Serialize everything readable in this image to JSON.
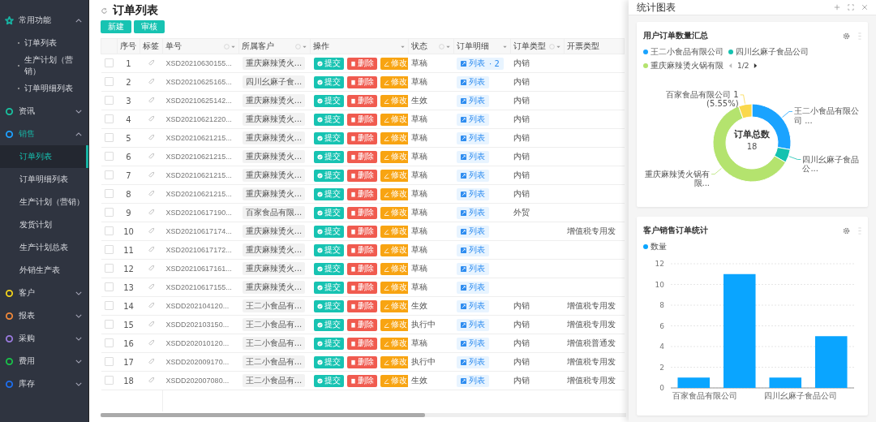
{
  "sidebar": {
    "groups": [
      {
        "label": "常用功能",
        "kind": "star",
        "color": "#17b3a3",
        "expanded": true,
        "children": [
          {
            "label": "订单列表",
            "selected": false
          },
          {
            "label": "生产计划（营销）",
            "selected": false
          },
          {
            "label": "订单明细列表",
            "selected": false
          }
        ]
      },
      {
        "label": "资讯",
        "kind": "ring",
        "color": "#19c2a0",
        "expanded": false
      },
      {
        "label": "销售",
        "kind": "ring",
        "color": "#1ea0ff",
        "expanded": true,
        "children": [
          {
            "label": "订单列表",
            "selected": true
          },
          {
            "label": "订单明细列表",
            "selected": false
          },
          {
            "label": "生产计划（营销）",
            "selected": false
          },
          {
            "label": "发货计划",
            "selected": false
          },
          {
            "label": "生产计划总表",
            "selected": false
          },
          {
            "label": "外销生产表",
            "selected": false
          }
        ]
      },
      {
        "label": "客户",
        "kind": "ring",
        "color": "#f2d21b",
        "expanded": false
      },
      {
        "label": "报表",
        "kind": "ring",
        "color": "#f0883a",
        "expanded": false
      },
      {
        "label": "采购",
        "kind": "ring",
        "color": "#9b7be0",
        "expanded": false
      },
      {
        "label": "费用",
        "kind": "ring",
        "color": "#19c34a",
        "expanded": false
      },
      {
        "label": "库存",
        "kind": "ring",
        "color": "#1e6ff0",
        "expanded": false
      }
    ]
  },
  "page": {
    "title": "订单列表",
    "buttons": [
      "新建",
      "审核"
    ]
  },
  "table": {
    "columns": [
      {
        "label": "序号",
        "info": false,
        "filter": false
      },
      {
        "label": "标签",
        "info": false,
        "filter": false
      },
      {
        "label": "单号",
        "info": true,
        "filter": true
      },
      {
        "label": "所属客户",
        "info": true,
        "filter": true
      },
      {
        "label": "操作",
        "info": false,
        "filter": true
      },
      {
        "label": "状态",
        "info": true,
        "filter": true
      },
      {
        "label": "订单明细",
        "info": false,
        "filter": true
      },
      {
        "label": "订单类型",
        "info": true,
        "filter": true
      },
      {
        "label": "开票类型",
        "info": false,
        "filter": false
      }
    ],
    "rows": [
      {
        "checked": false,
        "no": "1",
        "order": "XSD20210630155...",
        "customer": "重庆麻辣烫火...",
        "actions": [
          "提交",
          "删除",
          "修改"
        ],
        "status": "草稿",
        "detail": "列表",
        "detail_count": "· 2",
        "type": "内销",
        "invoice": ""
      },
      {
        "checked": false,
        "no": "2",
        "order": "XSD20210625165...",
        "customer": "四川幺麻子食...",
        "actions": [
          "提交",
          "删除",
          "修改"
        ],
        "status": "草稿",
        "detail": "列表",
        "type": "内销",
        "invoice": ""
      },
      {
        "checked": false,
        "no": "3",
        "order": "XSD20210625142...",
        "customer": "重庆麻辣烫火...",
        "actions": [
          "提交",
          "删除",
          "修改"
        ],
        "status": "生效",
        "detail": "列表",
        "type": "内销",
        "invoice": ""
      },
      {
        "checked": false,
        "no": "4",
        "order": "XSD20210621220...",
        "customer": "重庆麻辣烫火...",
        "actions": [
          "提交",
          "删除",
          "修改"
        ],
        "status": "草稿",
        "detail": "列表",
        "type": "内销",
        "invoice": ""
      },
      {
        "checked": false,
        "no": "5",
        "order": "XSD20210621215...",
        "customer": "重庆麻辣烫火...",
        "actions": [
          "提交",
          "删除",
          "修改"
        ],
        "status": "草稿",
        "detail": "列表",
        "type": "内销",
        "invoice": ""
      },
      {
        "checked": false,
        "no": "6",
        "order": "XSD20210621215...",
        "customer": "重庆麻辣烫火...",
        "actions": [
          "提交",
          "删除",
          "修改"
        ],
        "status": "草稿",
        "detail": "列表",
        "type": "内销",
        "invoice": ""
      },
      {
        "checked": false,
        "no": "7",
        "order": "XSD20210621215...",
        "customer": "重庆麻辣烫火...",
        "actions": [
          "提交",
          "删除",
          "修改"
        ],
        "status": "草稿",
        "detail": "列表",
        "type": "内销",
        "invoice": ""
      },
      {
        "checked": false,
        "no": "8",
        "order": "XSD20210621215...",
        "customer": "重庆麻辣烫火...",
        "actions": [
          "提交",
          "删除",
          "修改"
        ],
        "status": "草稿",
        "detail": "列表",
        "type": "内销",
        "invoice": ""
      },
      {
        "checked": false,
        "no": "9",
        "order": "XSD20210617190...",
        "customer": "百家食品有限...",
        "actions": [
          "提交",
          "删除",
          "修改"
        ],
        "status": "草稿",
        "detail": "列表",
        "type": "外贸",
        "invoice": ""
      },
      {
        "checked": false,
        "no": "10",
        "order": "XSD20210617174...",
        "customer": "重庆麻辣烫火...",
        "actions": [
          "提交",
          "删除",
          "修改"
        ],
        "status": "草稿",
        "detail": "列表",
        "type": "",
        "invoice": "增值税专用发"
      },
      {
        "checked": false,
        "no": "11",
        "order": "XSD20210617172...",
        "customer": "重庆麻辣烫火...",
        "actions": [
          "提交",
          "删除",
          "修改"
        ],
        "status": "草稿",
        "detail": "列表",
        "type": "",
        "invoice": ""
      },
      {
        "checked": false,
        "no": "12",
        "order": "XSD20210617161...",
        "customer": "重庆麻辣烫火...",
        "actions": [
          "提交",
          "删除",
          "修改"
        ],
        "status": "草稿",
        "detail": "列表",
        "type": "",
        "invoice": ""
      },
      {
        "checked": false,
        "no": "13",
        "order": "XSD20210617155...",
        "customer": "重庆麻辣烫火...",
        "actions": [
          "提交",
          "删除",
          "修改"
        ],
        "status": "草稿",
        "detail": "列表",
        "type": "",
        "invoice": ""
      },
      {
        "checked": false,
        "no": "14",
        "order": "XSDD202104120...",
        "customer": "王二小食品有...",
        "actions": [
          "提交",
          "删除",
          "修改"
        ],
        "status": "生效",
        "detail": "列表",
        "type": "内销",
        "invoice": "增值税专用发"
      },
      {
        "checked": false,
        "no": "15",
        "order": "XSDD202103150...",
        "customer": "王二小食品有...",
        "actions": [
          "提交",
          "删除",
          "修改"
        ],
        "status": "执行中",
        "detail": "列表",
        "type": "内销",
        "invoice": "增值税专用发"
      },
      {
        "checked": false,
        "no": "16",
        "order": "XSDD202010120...",
        "customer": "王二小食品有...",
        "actions": [
          "提交",
          "删除",
          "修改"
        ],
        "status": "草稿",
        "detail": "列表",
        "type": "内销",
        "invoice": "增值税普通发"
      },
      {
        "checked": false,
        "no": "17",
        "order": "XSDD202009170...",
        "customer": "王二小食品有...",
        "actions": [
          "提交",
          "删除",
          "修改"
        ],
        "status": "执行中",
        "detail": "列表",
        "type": "内销",
        "invoice": "增值税专用发"
      },
      {
        "checked": false,
        "no": "18",
        "order": "XSDD202007080...",
        "customer": "王二小食品有...",
        "actions": [
          "提交",
          "删除",
          "修改"
        ],
        "status": "生效",
        "detail": "列表",
        "type": "内销",
        "invoice": "增值税专用发"
      }
    ]
  },
  "drawer": {
    "title": "统计图表",
    "donut_card": {
      "title": "用户订单数量汇总",
      "legend": [
        {
          "name": "王二小食品有限公司",
          "color": "#1aa3ff"
        },
        {
          "name": "四川幺麻子食品公司",
          "color": "#14c2b0"
        },
        {
          "name": "重庆麻辣烫火锅有限",
          "color": "#b4e36e"
        }
      ],
      "legend_page": "1/2",
      "center_title": "订单总数",
      "center_value": "18",
      "chart_data": {
        "type": "donut",
        "categories": [
          "王二小食品有限公司 ...",
          "四川幺麻子食品公...",
          "重庆麻辣烫火锅有限...",
          "百家食品有限公司 1 (5.55%)"
        ],
        "values": [
          5,
          1,
          11,
          1
        ],
        "colors": [
          "#1aa3ff",
          "#14c2b0",
          "#b4e36e",
          "#fad84b"
        ]
      }
    },
    "bar_card": {
      "title": "客户销售订单统计",
      "chart_data": {
        "type": "bar",
        "categories": [
          "百家食品有限公司",
          null,
          "四川幺麻子食品公司",
          null
        ],
        "series": [
          {
            "name": "数量",
            "color": "#0aa5ff",
            "values": [
              1,
              11,
              1,
              5
            ]
          }
        ],
        "ylim": [
          0,
          12
        ],
        "yticks": [
          0,
          2,
          4,
          6,
          8,
          10,
          12
        ],
        "grid": true
      }
    }
  }
}
